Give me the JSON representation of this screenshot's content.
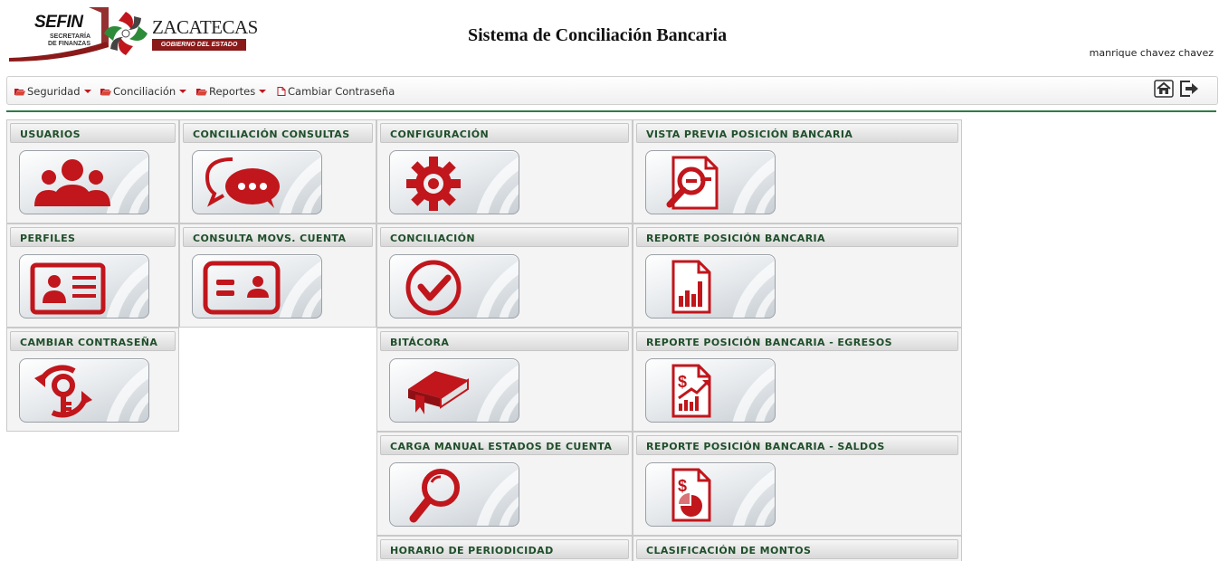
{
  "header": {
    "logo": {
      "sefin_title": "SEFIN",
      "sefin_line1": "SECRETARÍA",
      "sefin_line2": "DE FINANZAS",
      "zac_title": "ZACATECAS",
      "zac_sub": "GOBIERNO DEL ESTADO"
    },
    "app_title": "Sistema de Conciliación Bancaria",
    "user_name": "manrique chavez chavez"
  },
  "menu": {
    "items": [
      {
        "label": "Seguridad",
        "icon": "folder-open-icon",
        "dropdown": true
      },
      {
        "label": "Conciliación",
        "icon": "folder-open-icon",
        "dropdown": true
      },
      {
        "label": "Reportes",
        "icon": "folder-open-icon",
        "dropdown": true
      },
      {
        "label": "Cambiar Contraseña",
        "icon": "document-icon",
        "dropdown": false
      }
    ],
    "tools": [
      {
        "name": "home-icon"
      },
      {
        "name": "logout-icon"
      }
    ]
  },
  "colors": {
    "accent_red": "#c0161c",
    "tile_title_green": "#1f4f2a",
    "rule_green": "#2f7a4a"
  },
  "tiles": [
    {
      "title": "USUARIOS",
      "icon": "users-icon"
    },
    {
      "title": "PERFILES",
      "icon": "id-card-icon"
    },
    {
      "title": "CAMBIAR CONTRASEÑA",
      "icon": "key-refresh-icon"
    },
    {
      "title": "CONCILIACIÓN CONSULTAS",
      "icon": "chat-bubbles-icon"
    },
    {
      "title": "CONSULTA MOVS. CUENTA",
      "icon": "accounts-card-icon"
    },
    {
      "title": "CONFIGURACIÓN",
      "icon": "gear-icon"
    },
    {
      "title": "CONCILIACIÓN",
      "icon": "check-circle-icon"
    },
    {
      "title": "BITÁCORA",
      "icon": "book-icon"
    },
    {
      "title": "CARGA MANUAL ESTADOS DE CUENTA",
      "icon": "magnifier-icon"
    },
    {
      "title": "HORARIO DE PERIODICIDAD",
      "icon": ""
    },
    {
      "title": "VISTA PREVIA POSICIÓN BANCARIA",
      "icon": "document-search-icon"
    },
    {
      "title": "REPORTE POSICIÓN BANCARIA",
      "icon": "document-chart-icon"
    },
    {
      "title": "REPORTE POSICIÓN BANCARIA - EGRESOS",
      "icon": "document-money-chart-icon"
    },
    {
      "title": "REPORTE POSICIÓN BANCARIA - SALDOS",
      "icon": "document-pie-icon"
    },
    {
      "title": "CLASIFICACIÓN DE MONTOS",
      "icon": ""
    }
  ]
}
